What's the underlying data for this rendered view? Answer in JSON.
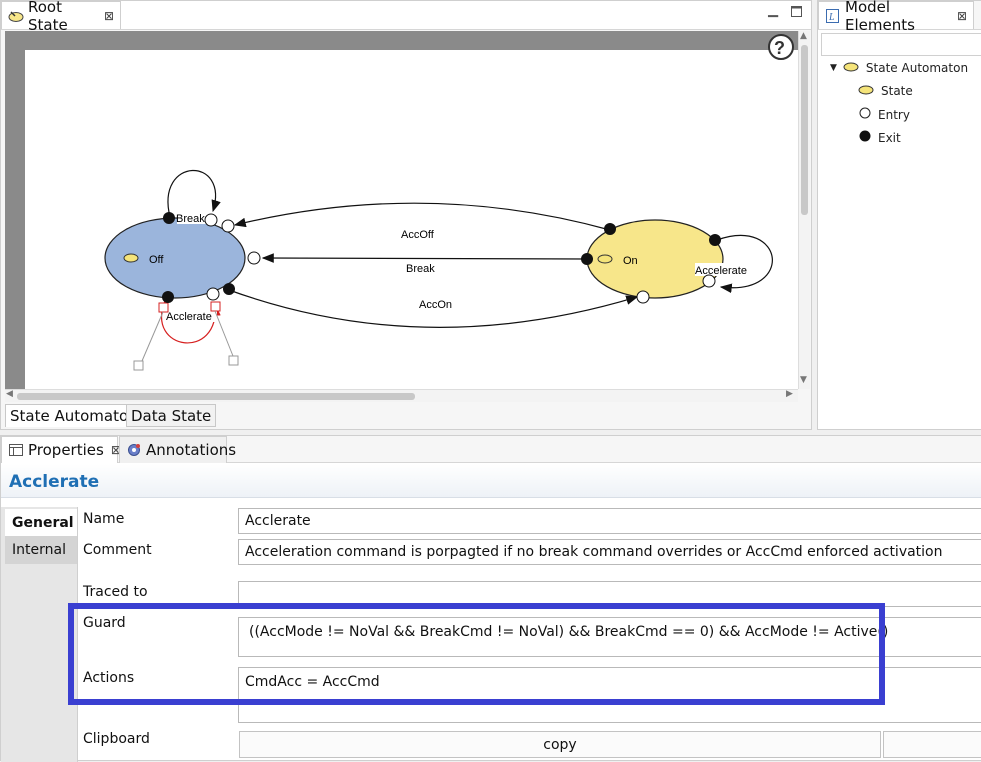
{
  "editor": {
    "tab_title": "Root State",
    "help_glyph": "?",
    "bottom_tabs": [
      "State Automaton",
      "Data State"
    ]
  },
  "diagram": {
    "states": [
      {
        "name": "Off",
        "color": "#9bb5dc"
      },
      {
        "name": "On",
        "color": "#f7e68a"
      }
    ],
    "transitions": [
      {
        "label": "AccOff"
      },
      {
        "label": "Break"
      },
      {
        "label": "AccOn"
      },
      {
        "label": "Break"
      },
      {
        "label": "Acclerate"
      },
      {
        "label": "Accelerate"
      }
    ],
    "selection_color": "#d62020"
  },
  "model_elements": {
    "tab_title": "Model Elements",
    "items": [
      {
        "label": "State Automaton",
        "icon": "yellow-ellipse-icon"
      },
      {
        "label": "State",
        "icon": "yellow-ellipse-icon"
      },
      {
        "label": "Entry",
        "icon": "hollow-circle-icon"
      },
      {
        "label": "Exit",
        "icon": "filled-circle-icon"
      }
    ]
  },
  "properties": {
    "tabs": [
      "Properties",
      "Annotations"
    ],
    "title": "Acclerate",
    "side_tabs": [
      "General",
      "Internal"
    ],
    "fields": {
      "name_label": "Name",
      "name_value": "Acclerate",
      "comment_label": "Comment",
      "comment_value": "Acceleration command is porpagted if no break command overrides or AccCmd enforced activation",
      "traced_label": "Traced to",
      "traced_value": "",
      "guard_label": "Guard",
      "guard_value": "((AccMode != NoVal && BreakCmd != NoVal) && BreakCmd == 0) && AccMode != Active()",
      "actions_label": "Actions",
      "actions_value": "CmdAcc = AccCmd",
      "clipboard_label": "Clipboard",
      "copy_button": "copy"
    },
    "highlight_color": "#3a3fd1"
  }
}
